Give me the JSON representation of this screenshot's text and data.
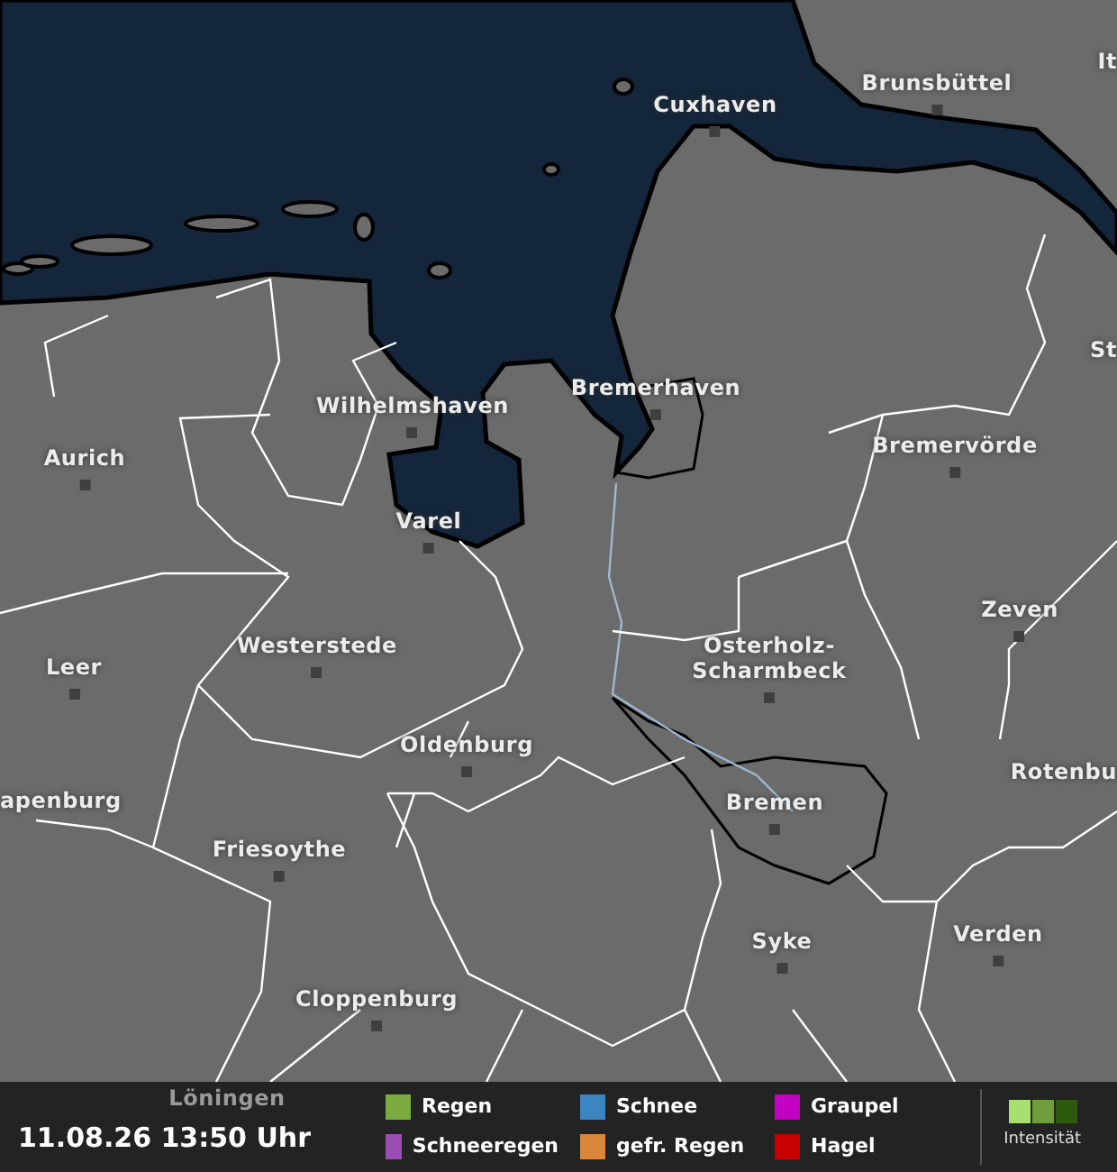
{
  "map": {
    "cities": [
      {
        "name": "Cuxhaven"
      },
      {
        "name": "Brunsbüttel"
      },
      {
        "name": "It"
      },
      {
        "name": "Wilhelmshaven"
      },
      {
        "name": "Bremerhaven"
      },
      {
        "name": "Aurich"
      },
      {
        "name": "Bremervörde"
      },
      {
        "name": "St"
      },
      {
        "name": "Varel"
      },
      {
        "name": "Westerstede"
      },
      {
        "name": "Leer"
      },
      {
        "name": "Osterholz-Scharmbeck"
      },
      {
        "name": "Zeven"
      },
      {
        "name": "Oldenburg"
      },
      {
        "name": "Bremen"
      },
      {
        "name": "Rotenbu"
      },
      {
        "name": "apenburg"
      },
      {
        "name": "Friesoythe"
      },
      {
        "name": "Syke"
      },
      {
        "name": "Verden"
      },
      {
        "name": "Cloppenburg"
      },
      {
        "name": "Löningen"
      }
    ]
  },
  "footer": {
    "timestamp": "11.08.26 13:50 Uhr",
    "legend": [
      {
        "label": "Regen",
        "color": "#7aab3e"
      },
      {
        "label": "Schneeregen",
        "color": "#9a4db3"
      },
      {
        "label": "Schnee",
        "color": "#3d85c0"
      },
      {
        "label": "gefr. Regen",
        "color": "#d9873a"
      },
      {
        "label": "Graupel",
        "color": "#c400c4"
      },
      {
        "label": "Hagel",
        "color": "#c80000"
      }
    ],
    "intensity_label": "Intensität"
  }
}
